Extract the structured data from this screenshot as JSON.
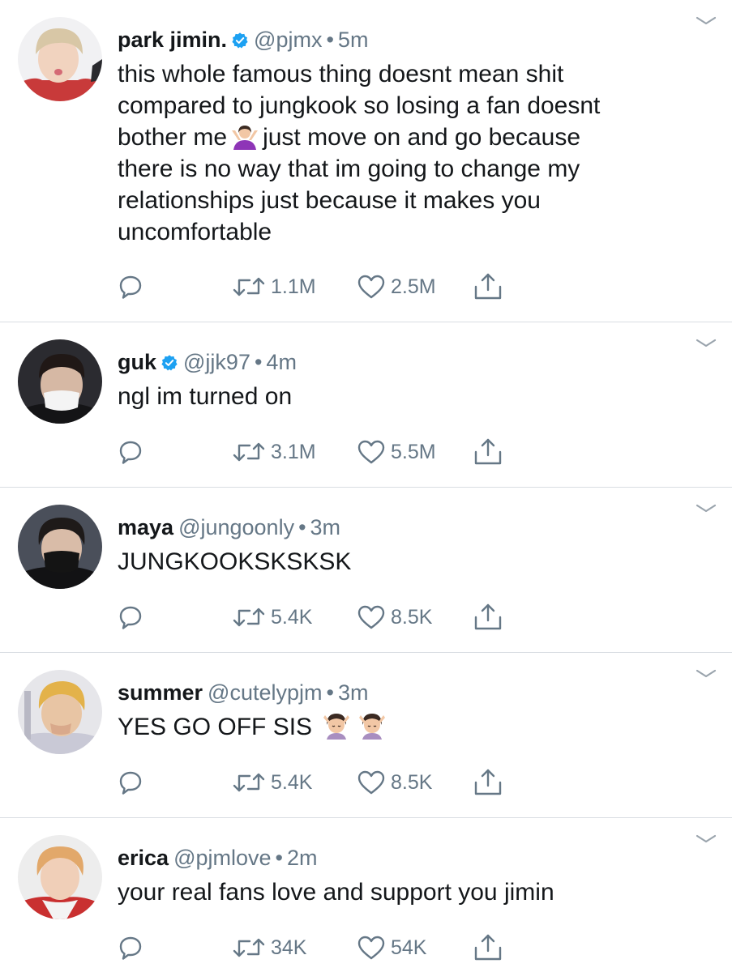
{
  "tweets": [
    {
      "name": "park jimin.",
      "verified": true,
      "handle": "@pjmx",
      "dot": "•",
      "time": "5m",
      "text_lines": [
        "this whole famous thing doesnt mean shit",
        "compared to jungkook so losing a fan doesnt",
        "bother me",
        "just move on and go because",
        "there is no way that im going to change my",
        "relationships just because it makes you",
        "uncomfortable"
      ],
      "emoji": "person-shrugging-emoji",
      "retweets": "1.1M",
      "likes": "2.5M"
    },
    {
      "name": "guk",
      "verified": true,
      "handle": "@jjk97",
      "dot": "•",
      "time": "4m",
      "text": "ngl im turned on",
      "retweets": "3.1M",
      "likes": "5.5M"
    },
    {
      "name": "maya",
      "verified": false,
      "handle": "@jungoonly",
      "dot": "•",
      "time": "3m",
      "text": "JUNGKOOKSKSKSK",
      "retweets": "5.4K",
      "likes": "8.5K"
    },
    {
      "name": "summer",
      "verified": false,
      "handle": "@cutelypjm",
      "dot": "•",
      "time": "3m",
      "text": "YES GO OFF SIS",
      "emoji": "person-getting-massage-emoji",
      "retweets": "5.4K",
      "likes": "8.5K"
    },
    {
      "name": "erica",
      "verified": false,
      "handle": "@pjmlove",
      "dot": "•",
      "time": "2m",
      "text": "your real fans love and support you jimin",
      "retweets": "34K",
      "likes": "54K"
    }
  ],
  "icons": {
    "reply": "reply-icon",
    "retweet": "retweet-icon",
    "like": "heart-icon",
    "share": "share-icon",
    "menu": "chevron-down-icon",
    "verified": "verified-badge-icon"
  },
  "colors": {
    "text": "#14171a",
    "secondary": "#657786",
    "verified": "#1da1f2",
    "divider": "#d9dde2"
  }
}
